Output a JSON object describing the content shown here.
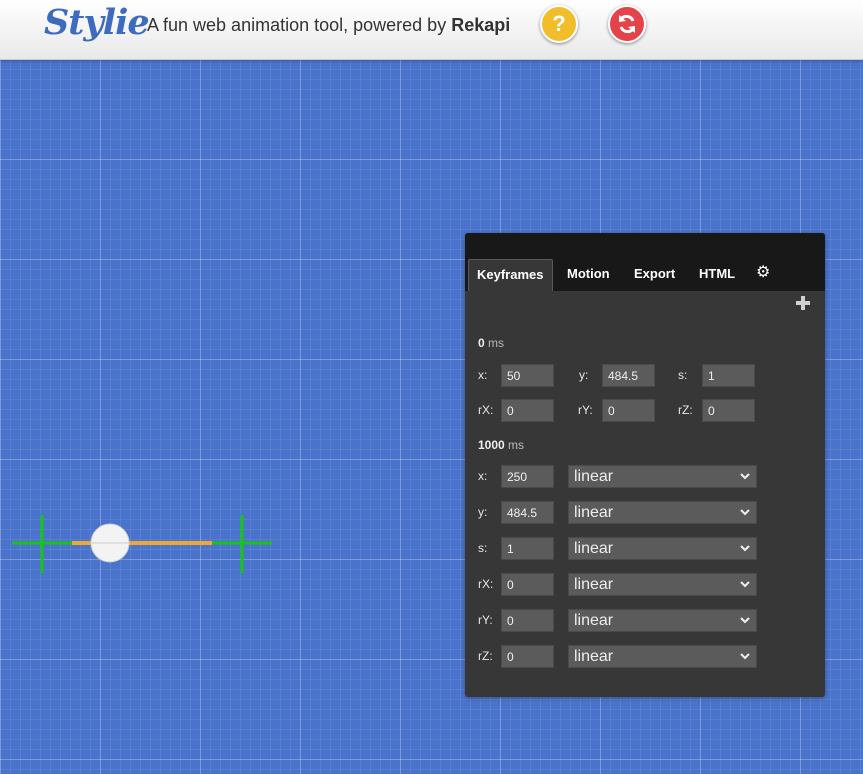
{
  "header": {
    "logo": "Stylie",
    "tagline": "A fun web animation tool, powered by ",
    "tagline_brand": "Rekapi",
    "help_label": "?",
    "help_icon": "question-icon",
    "reset_icon": "refresh-icon"
  },
  "colors": {
    "canvas": "#4a74cc",
    "help": "#f1bd2b",
    "reset": "#e44349",
    "path": "#f0a830",
    "crosshair": "#18c418"
  },
  "panel": {
    "tabs": [
      "Keyframes",
      "Motion",
      "Export",
      "HTML"
    ],
    "active_tab": "Keyframes",
    "settings_icon": "gear-icon",
    "add_icon": "plus-icon",
    "unit": "ms",
    "keyframes": [
      {
        "time": "0",
        "x_label": "x:",
        "x": "50",
        "y_label": "y:",
        "y": "484.5",
        "s_label": "s:",
        "s": "1",
        "rx_label": "rX:",
        "rx": "0",
        "ry_label": "rY:",
        "ry": "0",
        "rz_label": "rZ:",
        "rz": "0"
      },
      {
        "time": "1000",
        "props": [
          {
            "label": "x:",
            "value": "250",
            "easing": "linear"
          },
          {
            "label": "y:",
            "value": "484.5",
            "easing": "linear"
          },
          {
            "label": "s:",
            "value": "1",
            "easing": "linear"
          },
          {
            "label": "rX:",
            "value": "0",
            "easing": "linear"
          },
          {
            "label": "rY:",
            "value": "0",
            "easing": "linear"
          },
          {
            "label": "rZ:",
            "value": "0",
            "easing": "linear"
          }
        ]
      }
    ]
  }
}
